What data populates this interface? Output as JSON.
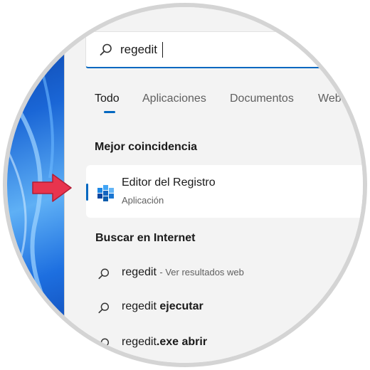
{
  "search": {
    "value": "regedit"
  },
  "tabs": [
    {
      "label": "Todo"
    },
    {
      "label": "Aplicaciones"
    },
    {
      "label": "Documentos"
    },
    {
      "label": "Web"
    }
  ],
  "best_match": {
    "title": "Mejor coincidencia",
    "app_name": "Editor del Registro",
    "app_type": "Aplicación",
    "icon": "registry-editor-icon"
  },
  "web_search": {
    "title": "Buscar en Internet",
    "items": [
      {
        "term": "regedit",
        "suffix": "- Ver resultados web"
      },
      {
        "term": "regedit",
        "suffix": "ejecutar"
      },
      {
        "term": "regedit",
        "suffix": ".exe abrir"
      }
    ]
  },
  "colors": {
    "accent": "#0067c0",
    "pointer_arrow": "#e8344e",
    "panel_bg": "#f3f3f3"
  }
}
